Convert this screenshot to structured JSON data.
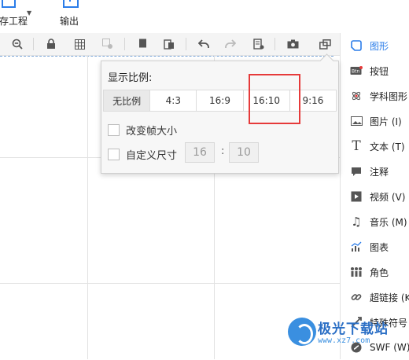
{
  "top_bar": {
    "save_label": "存工程",
    "export_label": "输出"
  },
  "toolbar": {
    "icons": [
      "zoom-out-icon",
      "lock-icon",
      "grid-icon",
      "settings-grid-icon",
      "copy-icon",
      "paste-icon",
      "undo-icon",
      "redo-icon",
      "page-settings-icon",
      "camera-icon",
      "aspect-ratio-icon"
    ]
  },
  "ratio_popup": {
    "title": "显示比例:",
    "options": [
      "无比例",
      "4:3",
      "16:9",
      "16:10",
      "9:16"
    ],
    "selected": "无比例",
    "change_frame_label": "改变帧大小",
    "custom_size_label": "自定义尺寸",
    "width_value": "16",
    "height_value": "10",
    "separator": ":"
  },
  "right_panel": {
    "items": [
      {
        "label": "图形",
        "icon": "shape-icon"
      },
      {
        "label": "按钮",
        "icon": "button-icon"
      },
      {
        "label": "学科图形",
        "icon": "science-shape-icon"
      },
      {
        "label": "图片 (I)",
        "icon": "image-icon"
      },
      {
        "label": "文本 (T)",
        "icon": "text-icon"
      },
      {
        "label": "注释",
        "icon": "comment-icon"
      },
      {
        "label": "视频 (V)",
        "icon": "video-icon"
      },
      {
        "label": "音乐 (M)",
        "icon": "music-icon"
      },
      {
        "label": "图表",
        "icon": "chart-icon"
      },
      {
        "label": "角色",
        "icon": "character-icon"
      },
      {
        "label": "超链接 (K",
        "icon": "link-icon"
      },
      {
        "label": "特殊符号",
        "icon": "symbol-icon"
      },
      {
        "label": "SWF (W)",
        "icon": "swf-icon"
      }
    ]
  },
  "watermark": {
    "title": "极光下载站",
    "subtitle": "www.xz7.com"
  },
  "colors": {
    "accent": "#2b7de9",
    "highlight_box": "#e63a3a"
  }
}
